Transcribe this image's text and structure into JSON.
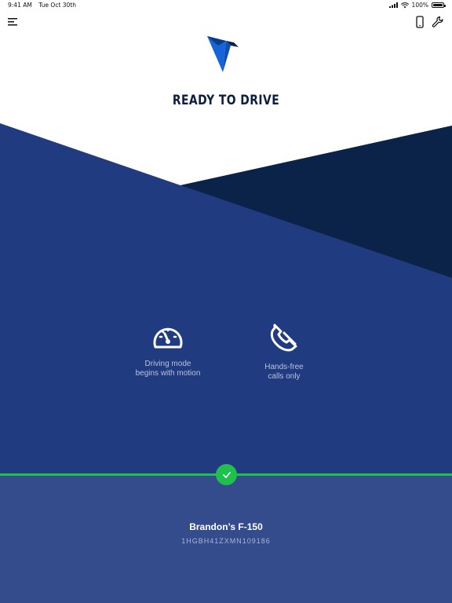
{
  "status_bar": {
    "time": "9:41 AM",
    "date": "Tue Oct 30th",
    "battery": "100%"
  },
  "header": {
    "title": "READY TO DRIVE"
  },
  "features": [
    {
      "icon": "speedometer-icon",
      "label": "Driving mode\nbegins with motion"
    },
    {
      "icon": "phone-handset-icon",
      "label": "Hands-free\ncalls only"
    }
  ],
  "vehicle": {
    "name": "Brandon’s F-150",
    "vin": "1HGBH41ZXMN109186",
    "connected": true
  },
  "colors": {
    "primary_blue": "#213b80",
    "dark_navy": "#0b2249",
    "panel_blue": "#354c8c",
    "success_green": "#1fc04d",
    "title_text": "#0b1f3f",
    "logo_blue": "#1565d8"
  }
}
